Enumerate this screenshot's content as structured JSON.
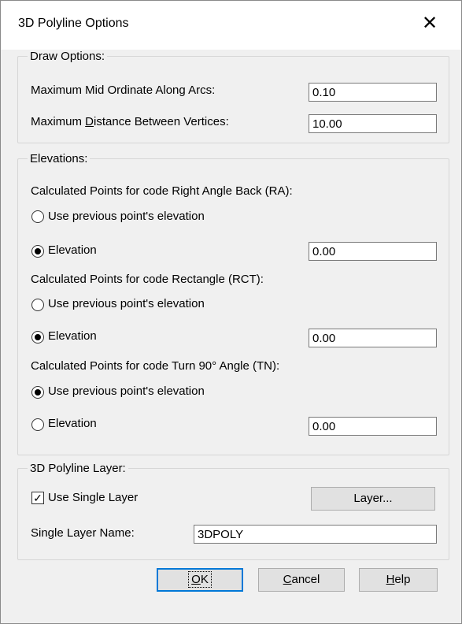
{
  "title": "3D Polyline Options",
  "close_glyph": "✕",
  "draw_options": {
    "legend": "Draw Options:",
    "mid_ordinate_label": "Maximum Mid Ordinate Along Arcs:",
    "mid_ordinate_value": "0.10",
    "distance_label_pre": "Maximum ",
    "distance_label_mnemonic": "D",
    "distance_label_post": "istance Between Vertices:",
    "distance_value": "10.00"
  },
  "elevations": {
    "legend": "Elevations:",
    "ra": {
      "heading": "Calculated Points for code Right Angle Back (RA):",
      "use_prev_label": "Use previous point's elevation",
      "use_prev_checked": false,
      "elev_label": "Elevation",
      "elev_checked": true,
      "elev_value": "0.00"
    },
    "rct": {
      "heading": "Calculated Points for code Rectangle (RCT):",
      "use_prev_label": "Use previous point's elevation",
      "use_prev_checked": false,
      "elev_label": "Elevation",
      "elev_checked": true,
      "elev_value": "0.00"
    },
    "tn": {
      "heading": "Calculated Points for code Turn 90° Angle (TN):",
      "use_prev_label": "Use previous point's elevation",
      "use_prev_checked": true,
      "elev_label": "Elevation",
      "elev_checked": false,
      "elev_value": "0.00"
    }
  },
  "layer": {
    "legend": "3D Polyline Layer:",
    "use_single_label": "Use Single Layer",
    "use_single_checked": true,
    "layer_button": "Layer...",
    "single_name_label": "Single Layer Name:",
    "single_name_value": "3DPOLY"
  },
  "buttons": {
    "ok_mnemonic": "O",
    "ok_rest": "K",
    "cancel_mnemonic": "C",
    "cancel_rest": "ancel",
    "help_mnemonic": "H",
    "help_rest": "elp"
  }
}
